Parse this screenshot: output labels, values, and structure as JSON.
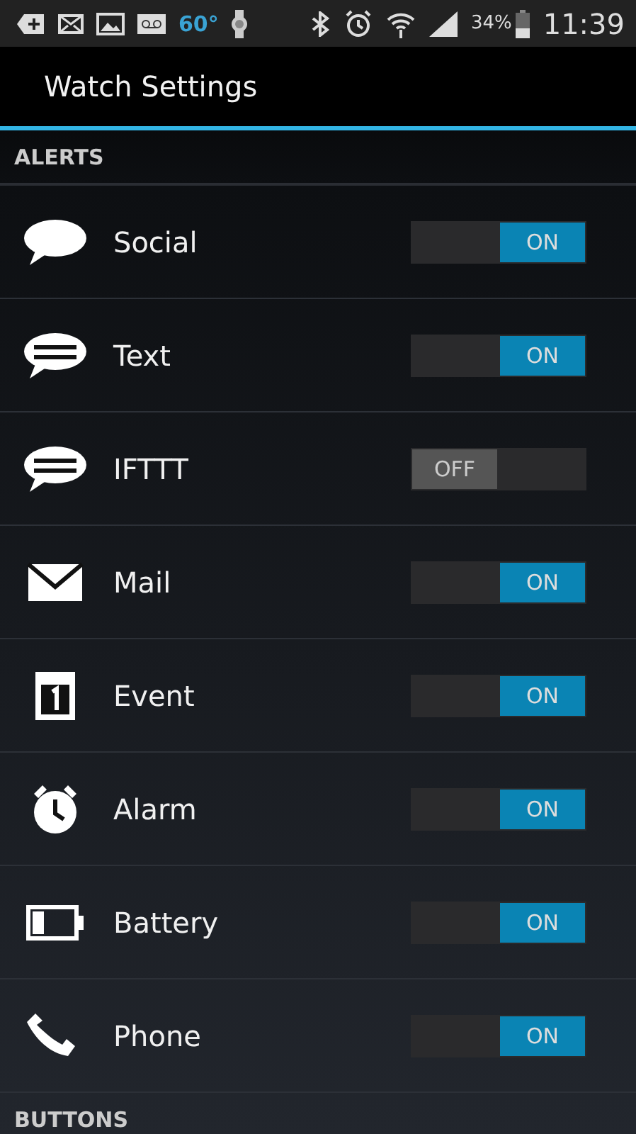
{
  "status_bar": {
    "temperature": "60°",
    "battery": "34%",
    "time": "11:39"
  },
  "action_bar": {
    "title": "Watch Settings"
  },
  "sections": [
    {
      "title": "ALERTS",
      "items": [
        {
          "label": "Social",
          "kind": "bubble",
          "on": true,
          "toggle_text": "ON"
        },
        {
          "label": "Text",
          "kind": "lines",
          "on": true,
          "toggle_text": "ON"
        },
        {
          "label": "IFTTT",
          "kind": "lines",
          "on": false,
          "toggle_text": "OFF"
        },
        {
          "label": "Mail",
          "kind": "mail",
          "on": true,
          "toggle_text": "ON"
        },
        {
          "label": "Event",
          "kind": "calendar",
          "on": true,
          "toggle_text": "ON"
        },
        {
          "label": "Alarm",
          "kind": "alarm",
          "on": true,
          "toggle_text": "ON"
        },
        {
          "label": "Battery",
          "kind": "battery",
          "on": true,
          "toggle_text": "ON"
        },
        {
          "label": "Phone",
          "kind": "phone",
          "on": true,
          "toggle_text": "ON"
        }
      ]
    },
    {
      "title": "BUTTONS"
    }
  ]
}
